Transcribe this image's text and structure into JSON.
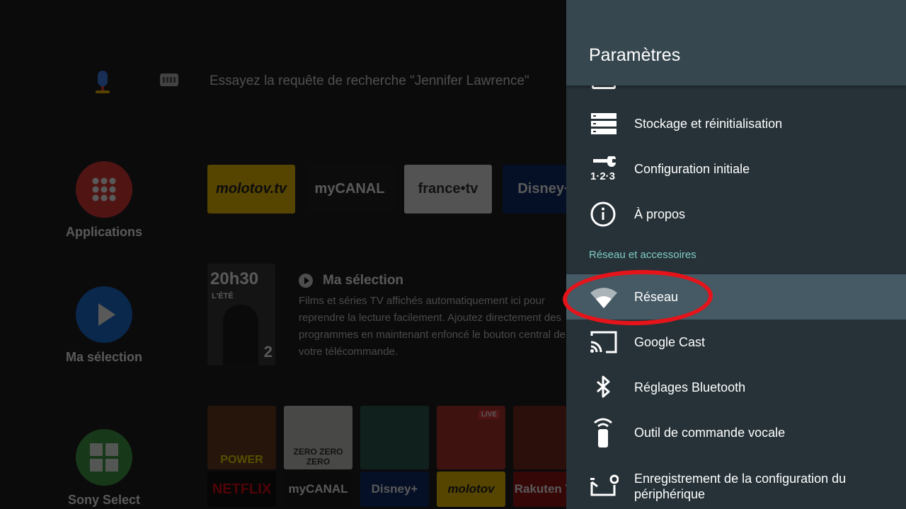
{
  "home": {
    "search_hint": "Essayez la requête de recherche \"Jennifer Lawrence\"",
    "nav": [
      {
        "label": "Applications",
        "icon": "apps-grid-icon"
      },
      {
        "label": "Ma sélection",
        "icon": "play-icon"
      },
      {
        "label": "Sony Select",
        "icon": "sony-select-icon"
      }
    ],
    "apps": [
      "molotov.tv",
      "myCANAL",
      "france•tv",
      "Disney+"
    ],
    "selection": {
      "thumb_title": "20h30",
      "thumb_subtitle": "L'ÉTÉ",
      "thumb_channel": "2",
      "title": "Ma sélection",
      "description": [
        "Films et séries TV affichés automatiquement ici pour",
        "reprendre la lecture facilement. Ajoutez directement des",
        "programmes en maintenant enfoncé le bouton central de",
        "votre télécommande."
      ]
    },
    "posters": [
      {
        "text": "POWER"
      },
      {
        "text": "ZERO ZERO ZERO"
      },
      {
        "text": ""
      },
      {
        "text": "",
        "badge": "LIVE"
      },
      {
        "text": ""
      }
    ],
    "brands": [
      "NETFLIX",
      "myCANAL",
      "Disney+",
      "molotov",
      "Rakuten TV"
    ]
  },
  "settings": {
    "title": "Paramètres",
    "section_network": "Réseau et accessoires",
    "items": [
      {
        "label": "Stockage et réinitialisation",
        "icon": "storage-icon"
      },
      {
        "label": "Configuration initiale",
        "icon": "setup-123-icon"
      },
      {
        "label": "À propos",
        "icon": "info-icon"
      },
      {
        "label": "Réseau",
        "icon": "wifi-icon",
        "selected": true
      },
      {
        "label": "Google Cast",
        "icon": "cast-icon"
      },
      {
        "label": "Réglages Bluetooth",
        "icon": "bluetooth-icon"
      },
      {
        "label": "Outil de commande vocale",
        "icon": "remote-icon"
      },
      {
        "label": "Enregistrement de la configuration du périphérique",
        "icon": "device-setup-icon"
      }
    ]
  },
  "colors": {
    "panel_bg": "#263238",
    "header_bg": "#37474f",
    "selected_bg": "#455a64",
    "section_accent": "#80cbc4",
    "highlight_ring": "#e5141a"
  }
}
